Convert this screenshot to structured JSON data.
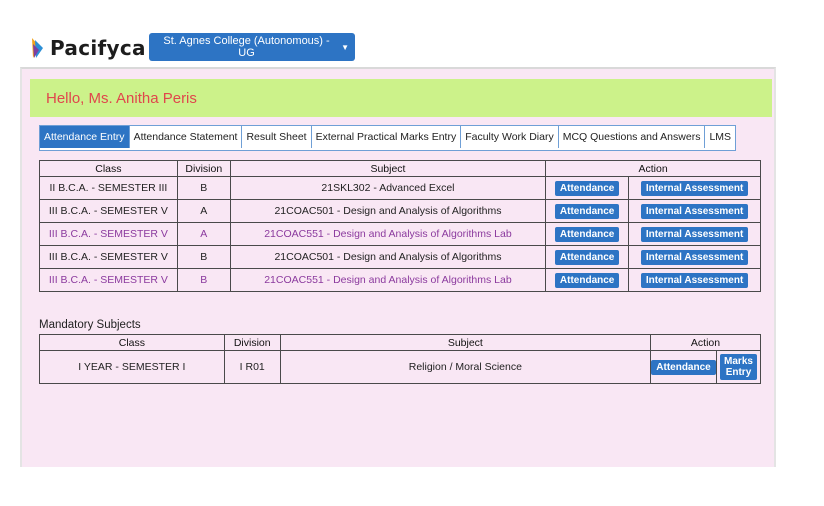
{
  "header": {
    "logo_text": "Pacifyca",
    "college_selector": "St. Agnes College (Autonomous) - UG"
  },
  "greeting": "Hello, Ms. Anitha Peris",
  "tabs": [
    {
      "label": "Attendance Entry",
      "active": true
    },
    {
      "label": "Attendance Statement"
    },
    {
      "label": "Result Sheet"
    },
    {
      "label": "External Practical Marks Entry"
    },
    {
      "label": "Faculty Work Diary"
    },
    {
      "label": "MCQ Questions and Answers"
    },
    {
      "label": "LMS"
    }
  ],
  "main_table": {
    "headers": {
      "class": "Class",
      "division": "Division",
      "subject": "Subject",
      "action": "Action"
    },
    "rows": [
      {
        "class": "II B.C.A. - SEMESTER III",
        "division": "B",
        "subject": "21SKL302 - Advanced Excel",
        "lab": false
      },
      {
        "class": "III B.C.A. - SEMESTER V",
        "division": "A",
        "subject": "21COAC501 - Design and Analysis of Algorithms",
        "lab": false
      },
      {
        "class": "III B.C.A. - SEMESTER V",
        "division": "A",
        "subject": "21COAC551 - Design and Analysis of Algorithms Lab",
        "lab": true
      },
      {
        "class": "III B.C.A. - SEMESTER V",
        "division": "B",
        "subject": "21COAC501 - Design and Analysis of Algorithms",
        "lab": false
      },
      {
        "class": "III B.C.A. - SEMESTER V",
        "division": "B",
        "subject": "21COAC551 - Design and Analysis of Algorithms Lab",
        "lab": true
      }
    ],
    "attendance_label": "Attendance",
    "internal_label": "Internal Assessment"
  },
  "mandatory": {
    "title": "Mandatory Subjects",
    "headers": {
      "class": "Class",
      "division": "Division",
      "subject": "Subject",
      "action": "Action"
    },
    "rows": [
      {
        "class": "I YEAR - SEMESTER I",
        "division": "I R01",
        "subject": "Religion / Moral Science"
      }
    ],
    "attendance_label": "Attendance",
    "marks_label_1": "Marks",
    "marks_label_2": "Entry"
  },
  "colors": {
    "primary": "#2d74c4",
    "greeting_bg": "#ccf28a",
    "greeting_text": "#e0474c",
    "panel_bg": "#f9e7f4",
    "lab_text": "#8b3a9e"
  }
}
